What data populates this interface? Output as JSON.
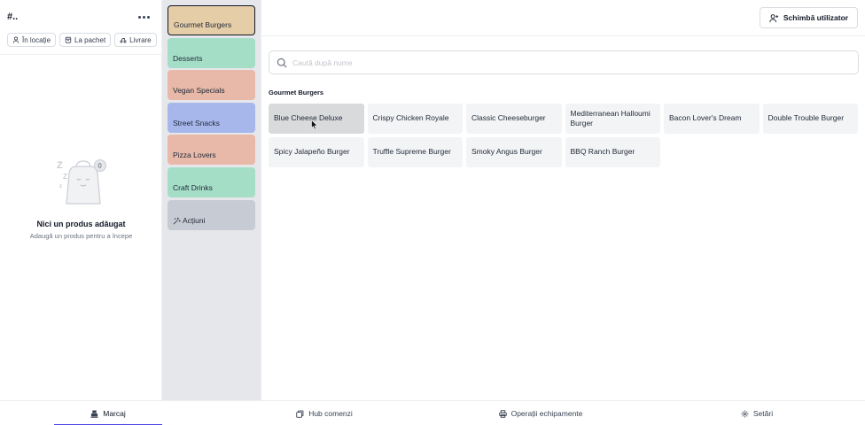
{
  "order": {
    "id": "#..",
    "modes": [
      {
        "label": "În locație",
        "icon": "person-icon"
      },
      {
        "label": "La pachet",
        "icon": "bag-icon"
      },
      {
        "label": "Livrare",
        "icon": "delivery-icon"
      }
    ],
    "empty_title": "Nici un produs adăugat",
    "empty_subtitle": "Adaugă un produs pentru a începe"
  },
  "categories": [
    {
      "label": "Gourmet Burgers",
      "color": "#e5cda8",
      "active": true
    },
    {
      "label": "Desserts",
      "color": "#a5dec7"
    },
    {
      "label": "Vegan Specials",
      "color": "#e8b9a8"
    },
    {
      "label": "Street Snacks",
      "color": "#a7b7ec"
    },
    {
      "label": "Pizza Lovers",
      "color": "#e8b9a8"
    },
    {
      "label": "Craft Drinks",
      "color": "#a5dec7"
    },
    {
      "label": "Acțiuni",
      "color": "#c7ccd4",
      "icon": "sparkle-icon"
    }
  ],
  "header": {
    "switch_user_label": "Schimbă utilizator"
  },
  "search": {
    "placeholder": "Caută după nume",
    "value": ""
  },
  "section_title": "Gourmet Burgers",
  "products": [
    {
      "name": "Blue Cheese Deluxe",
      "hover": true
    },
    {
      "name": "Crispy Chicken Royale"
    },
    {
      "name": "Classic Cheeseburger"
    },
    {
      "name": "Mediterranean Halloumi Burger"
    },
    {
      "name": "Bacon Lover's Dream"
    },
    {
      "name": "Double Trouble Burger"
    },
    {
      "name": "Spicy Jalapeño Burger"
    },
    {
      "name": "Truffle Supreme Burger"
    },
    {
      "name": "Smoky Angus Burger"
    },
    {
      "name": "BBQ Ranch Burger"
    }
  ],
  "bottom_nav": [
    {
      "label": "Marcaj",
      "icon": "register-icon",
      "active": true
    },
    {
      "label": "Hub comenzi",
      "icon": "orders-icon"
    },
    {
      "label": "Operații echipamente",
      "icon": "printer-icon"
    },
    {
      "label": "Setări",
      "icon": "gear-icon"
    }
  ],
  "colors": {
    "accent": "#4f46e5",
    "tile": "#f3f4f6",
    "tile_hover": "#d9dadc",
    "sidebar": "#e5e7eb"
  }
}
